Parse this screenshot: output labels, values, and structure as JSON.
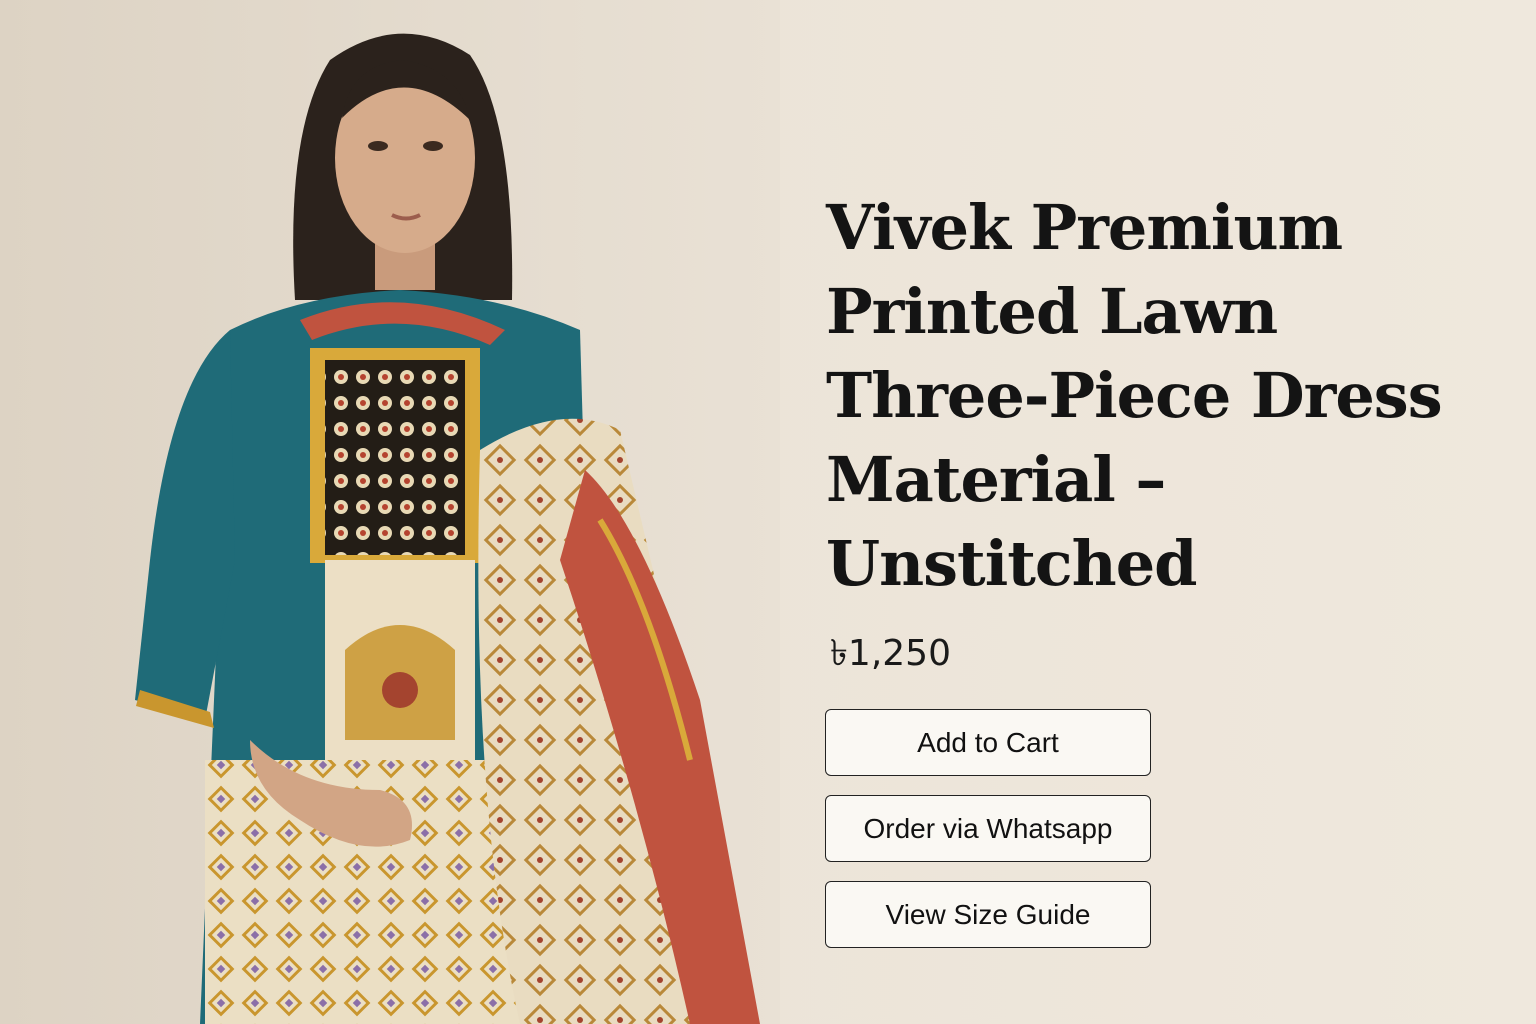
{
  "product": {
    "title": "Vivek Premium Printed Lawn Three-Piece Dress Material – Unstitched",
    "price": "৳1,250"
  },
  "actions": {
    "add_to_cart": "Add to Cart",
    "order_whatsapp": "Order via Whatsapp",
    "size_guide": "View Size Guide"
  },
  "colors": {
    "background": "#ece4d8",
    "text": "#141414",
    "button_bg": "#faf8f3",
    "button_border": "#222222",
    "dress_teal": "#1f6b78",
    "dress_cream": "#eadfc6",
    "dupatta_red": "#c0533f",
    "gold": "#c9962e"
  }
}
